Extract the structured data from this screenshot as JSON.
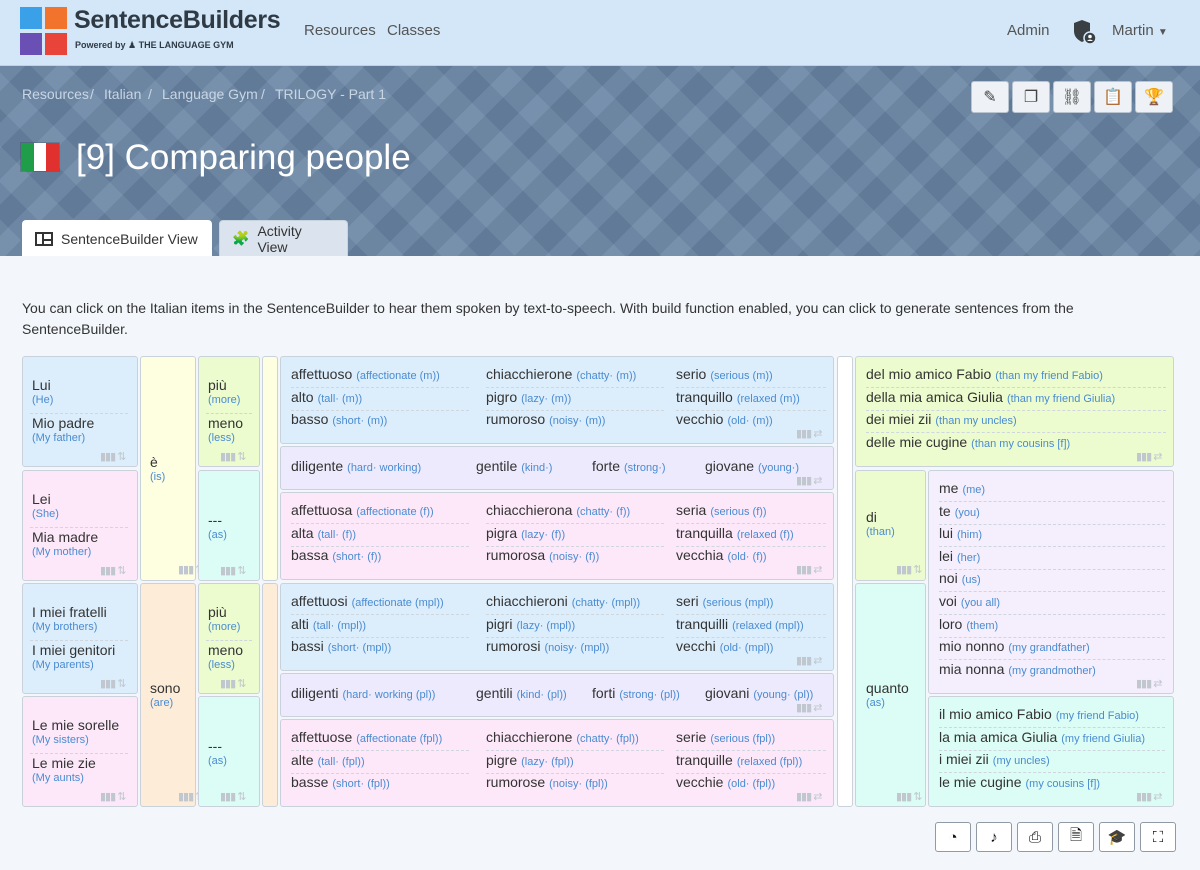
{
  "nav": {
    "brand": "SentenceBuilders",
    "powered": "Powered by",
    "gym": "THE LANGUAGE GYM",
    "links": [
      "Resources",
      "Classes"
    ],
    "admin": "Admin",
    "user": "Martin",
    "logo_colors": [
      "#3aa0e8",
      "#f2732b",
      "#6a4fb5",
      "#e8443a"
    ]
  },
  "breadcrumb": [
    "Resources",
    "Italian",
    "Language Gym",
    "TRILOGY - Part 1"
  ],
  "seps": [
    "/",
    "/",
    "/"
  ],
  "header_buttons": [
    "pencil-icon",
    "copy-icon",
    "link-icon",
    "clipboard-icon",
    "trophy-icon"
  ],
  "title": "[9] Comparing people",
  "flag_colors": [
    "#1f9d48",
    "#ffffff",
    "#e0312f"
  ],
  "tabs": [
    "SentenceBuilder View",
    "Activity View"
  ],
  "description": "You can click on the Italian items in the SentenceBuilder to hear them spoken by text-to-speech. With build function enabled, you can click to generate sentences from the SentenceBuilder.",
  "col1": [
    {
      "it": "Lui",
      "tr": "(He)"
    },
    {
      "it": "Mio padre",
      "tr": "(My father)"
    },
    {
      "it": "Lei",
      "tr": "(She)"
    },
    {
      "it": "Mia madre",
      "tr": "(My mother)"
    },
    {
      "it": "I miei fratelli",
      "tr": "(My brothers)"
    },
    {
      "it": "I miei genitori",
      "tr": "(My parents)"
    },
    {
      "it": "Le mie sorelle",
      "tr": "(My sisters)"
    },
    {
      "it": "Le mie zie",
      "tr": "(My aunts)"
    }
  ],
  "verbs": [
    {
      "it": "è",
      "tr": "(is)"
    },
    {
      "it": "sono",
      "tr": "(are)"
    }
  ],
  "comp": [
    {
      "it": "più",
      "tr": "(more)"
    },
    {
      "it": "meno",
      "tr": "(less)"
    },
    {
      "it": "---",
      "tr": "(as)"
    },
    {
      "it": "più",
      "tr": "(more)"
    },
    {
      "it": "meno",
      "tr": "(less)"
    },
    {
      "it": "---",
      "tr": "(as)"
    }
  ],
  "adj": [
    [
      [
        "affettuoso",
        "(affectionate (m))"
      ],
      [
        "chiacchierone",
        "(chatty· (m))"
      ],
      [
        "serio",
        "(serious (m))"
      ],
      [
        "alto",
        "(tall· (m))"
      ],
      [
        "pigro",
        "(lazy· (m))"
      ],
      [
        "tranquillo",
        "(relaxed (m))"
      ],
      [
        "basso",
        "(short· (m))"
      ],
      [
        "rumoroso",
        "(noisy· (m))"
      ],
      [
        "vecchio",
        "(old· (m))"
      ]
    ],
    [
      [
        "diligente",
        "(hard· working)"
      ],
      [
        "gentile",
        "(kind·)"
      ],
      [
        "forte",
        "(strong·)"
      ],
      [
        "giovane",
        "(young·)"
      ]
    ],
    [
      [
        "affettuosa",
        "(affectionate (f))"
      ],
      [
        "chiacchierona",
        "(chatty· (f))"
      ],
      [
        "seria",
        "(serious (f))"
      ],
      [
        "alta",
        "(tall· (f))"
      ],
      [
        "pigra",
        "(lazy· (f))"
      ],
      [
        "tranquilla",
        "(relaxed (f))"
      ],
      [
        "bassa",
        "(short· (f))"
      ],
      [
        "rumorosa",
        "(noisy· (f))"
      ],
      [
        "vecchia",
        "(old· (f))"
      ]
    ],
    [
      [
        "affettuosi",
        "(affectionate (mpl))"
      ],
      [
        "chiacchieroni",
        "(chatty· (mpl))"
      ],
      [
        "seri",
        "(serious (mpl))"
      ],
      [
        "alti",
        "(tall· (mpl))"
      ],
      [
        "pigri",
        "(lazy· (mpl))"
      ],
      [
        "tranquilli",
        "(relaxed (mpl))"
      ],
      [
        "bassi",
        "(short· (mpl))"
      ],
      [
        "rumorosi",
        "(noisy· (mpl))"
      ],
      [
        "vecchi",
        "(old· (mpl))"
      ]
    ],
    [
      [
        "diligenti",
        "(hard· working (pl))"
      ],
      [
        "gentili",
        "(kind· (pl))"
      ],
      [
        "forti",
        "(strong· (pl))"
      ],
      [
        "giovani",
        "(young· (pl))"
      ]
    ],
    [
      [
        "affettuose",
        "(affectionate (fpl))"
      ],
      [
        "chiacchierone",
        "(chatty· (fpl))"
      ],
      [
        "serie",
        "(serious (fpl))"
      ],
      [
        "alte",
        "(tall· (fpl))"
      ],
      [
        "pigre",
        "(lazy· (fpl))"
      ],
      [
        "tranquille",
        "(relaxed (fpl))"
      ],
      [
        "basse",
        "(short· (fpl))"
      ],
      [
        "rumorose",
        "(noisy· (fpl))"
      ],
      [
        "vecchie",
        "(old· (fpl))"
      ]
    ]
  ],
  "than_top": [
    [
      "del mio amico Fabio",
      "(than my friend Fabio)"
    ],
    [
      "della mia amica Giulia",
      "(than my friend Giulia)"
    ],
    [
      "dei miei zii",
      "(than my uncles)"
    ],
    [
      "delle mie cugine",
      "(than my cousins [f])"
    ]
  ],
  "di": {
    "it": "di",
    "tr": "(than)"
  },
  "quanto": {
    "it": "quanto",
    "tr": "(as)"
  },
  "pronouns": [
    [
      "me",
      "(me)"
    ],
    [
      "te",
      "(you)"
    ],
    [
      "lui",
      "(him)"
    ],
    [
      "lei",
      "(her)"
    ],
    [
      "noi",
      "(us)"
    ],
    [
      "voi",
      "(you all)"
    ],
    [
      "loro",
      "(them)"
    ],
    [
      "mio nonno",
      "(my grandfather)"
    ],
    [
      "mia nonna",
      "(my grandmother)"
    ]
  ],
  "quanto_list": [
    [
      "il mio amico Fabio",
      "(my friend Fabio)"
    ],
    [
      "la mia amica Giulia",
      "(my friend Giulia)"
    ],
    [
      "i miei zii",
      "(my uncles)"
    ],
    [
      "le mie cugine",
      "(my cousins [f])"
    ]
  ],
  "bottom_buttons": [
    "speedometer-icon",
    "music-icon",
    "print-icon",
    "document-icon",
    "graduation-cap-icon",
    "fullscreen-icon"
  ]
}
